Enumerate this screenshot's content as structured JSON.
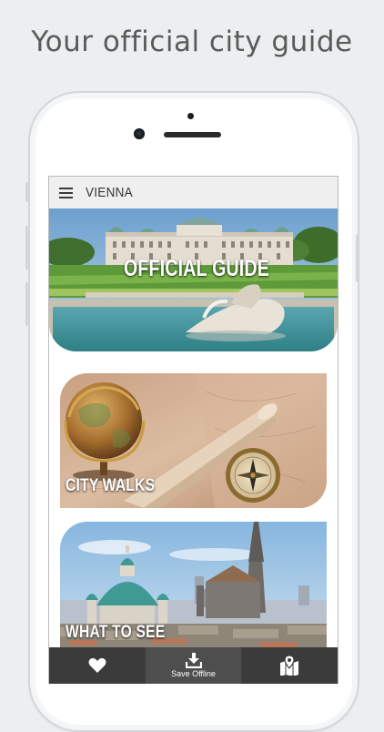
{
  "headline": "Your official city guide",
  "app": {
    "city": "VIENNA"
  },
  "cards": [
    {
      "label": "OFFICIAL GUIDE"
    },
    {
      "label": "CITY WALKS"
    },
    {
      "label": "WHAT TO SEE"
    }
  ],
  "tabbar": {
    "favorites_icon": "heart-icon",
    "offline_icon": "download-icon",
    "offline_label": "Save Offline",
    "map_icon": "map-pin-icon"
  },
  "colors": {
    "background": "#eceef0",
    "tabbar": "#3b3b3b",
    "tabbar_active": "#4e4e4e"
  }
}
